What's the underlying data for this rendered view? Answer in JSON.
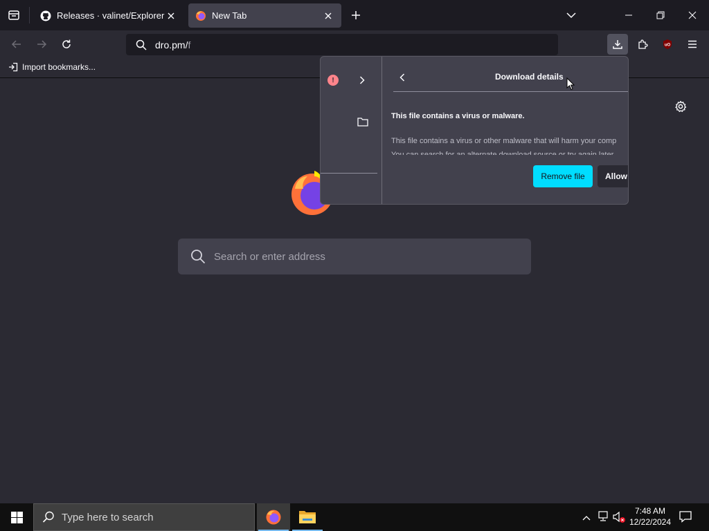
{
  "browser": {
    "tabs": [
      {
        "title": "Releases · valinet/ExplorerPatcher",
        "selected": false
      },
      {
        "title": "New Tab",
        "selected": true
      }
    ],
    "url": {
      "host": "dro.pm/",
      "path": "f"
    },
    "bookmarks": [
      {
        "label": "Import bookmarks..."
      }
    ]
  },
  "newtab": {
    "search_placeholder": "Search or enter address"
  },
  "download_panel": {
    "title": "Download details",
    "message_title": "This file contains a virus or malware.",
    "message_body_line1": "This file contains a virus or other malware that will harm your comp",
    "message_body_line2": "You can search for an alternate download source or try again later.",
    "remove_label": "Remove file",
    "allow_label": "Allow",
    "warning_glyph": "!"
  },
  "taskbar": {
    "search_placeholder": "Type here to search",
    "time": "7:48 AM",
    "date": "12/22/2024"
  },
  "extension_badge": "uO",
  "colors": {
    "accent": "#00ddff",
    "warning": "#ff848b",
    "toolbar": "#2b2a33",
    "tabstrip": "#1c1b22"
  }
}
